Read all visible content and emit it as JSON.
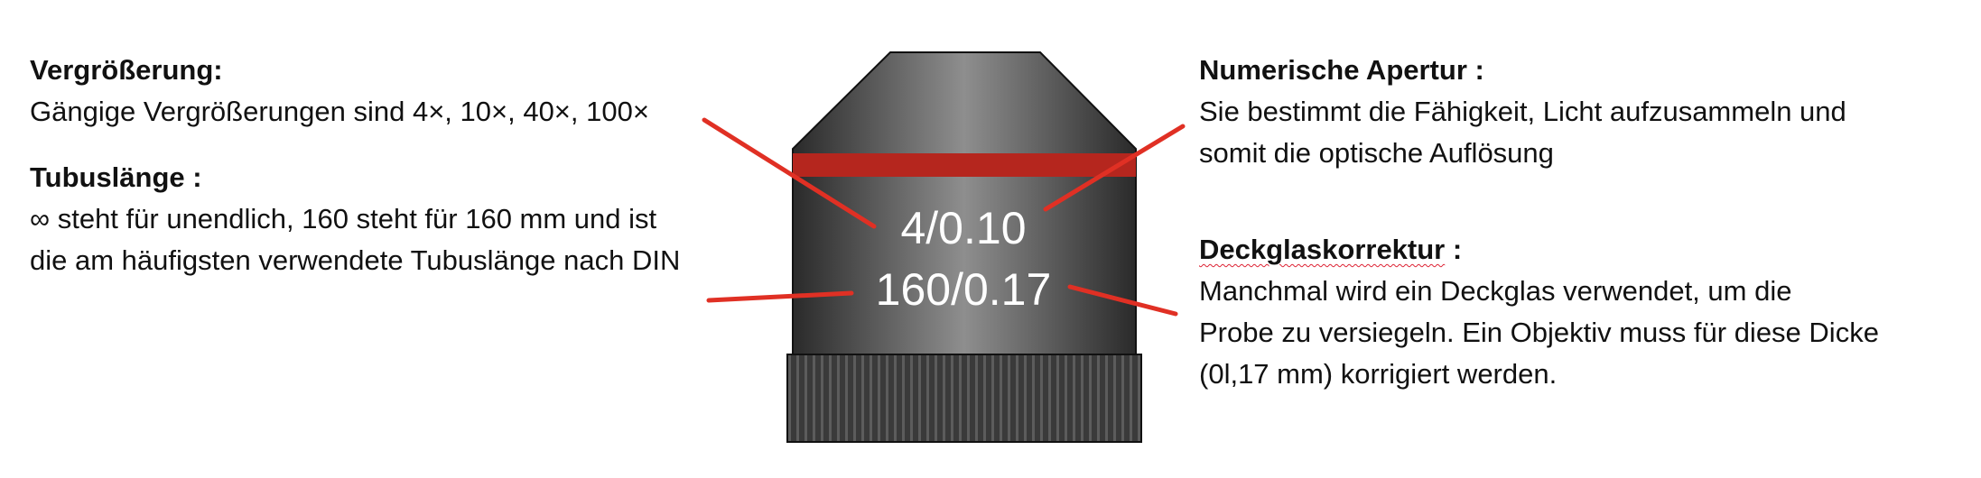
{
  "annotations": {
    "magnification": {
      "heading": "Vergrößerung:",
      "lines": [
        "Gängige Vergrößerungen sind 4×, 10×, 40×, 100×"
      ]
    },
    "tube_length": {
      "heading": "Tubuslänge :",
      "lines": [
        "∞ steht für unendlich, 160 steht für 160 mm und ist",
        "die am häufigsten verwendete Tubuslänge nach DIN"
      ]
    },
    "numerical_aperture": {
      "heading": "Numerische Apertur :",
      "lines": [
        "Sie bestimmt die Fähigkeit, Licht aufzusammeln und",
        "somit die optische Auflösung"
      ]
    },
    "coverslip_correction": {
      "heading_word": "Deckglaskorrektur",
      "heading_suffix": " :",
      "lines": [
        "Manchmal wird ein Deckglas verwendet, um die",
        "Probe zu versiegeln. Ein Objektiv muss für diese Dicke",
        "(0l,17 mm) korrigiert werden."
      ]
    }
  },
  "objective": {
    "line1": "4/0.10",
    "line2": "160/0.17",
    "band_color": "#b5261e",
    "pointer_color": "#e03024"
  }
}
